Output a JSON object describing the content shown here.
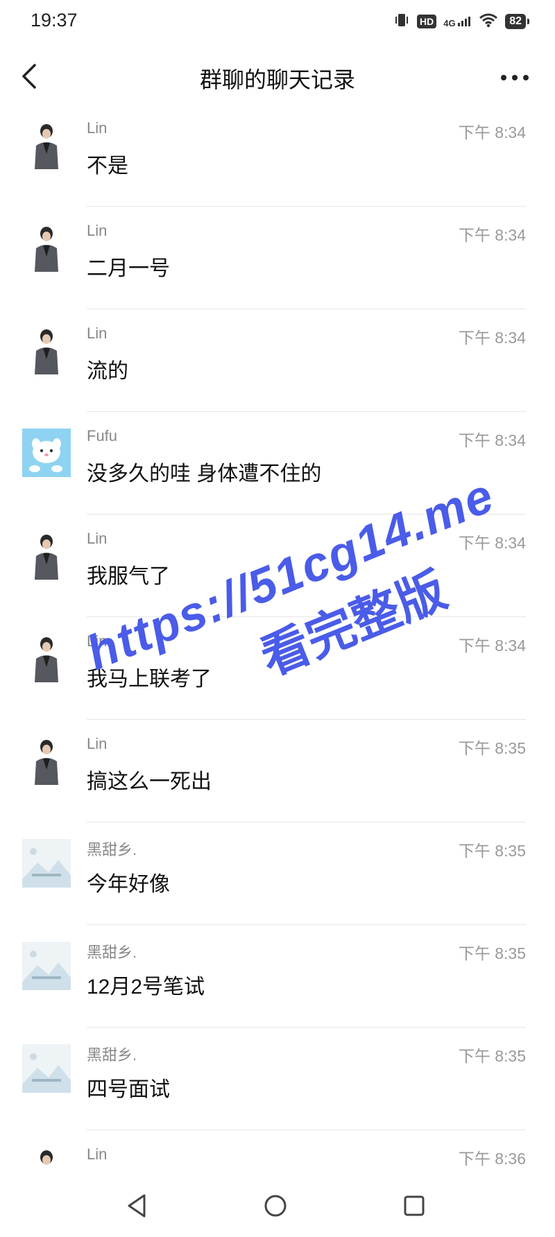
{
  "status_bar": {
    "time": "19:37",
    "hd": "HD",
    "network": "4G",
    "battery": "82"
  },
  "header": {
    "title": "群聊的聊天记录"
  },
  "messages": [
    {
      "sender": "Lin",
      "time": "下午 8:34",
      "text": "不是",
      "avatar": "man-avatar"
    },
    {
      "sender": "Lin",
      "time": "下午 8:34",
      "text": "二月一号",
      "avatar": "man-avatar"
    },
    {
      "sender": "Lin",
      "time": "下午 8:34",
      "text": "流的",
      "avatar": "man-avatar"
    },
    {
      "sender": "Fufu",
      "time": "下午 8:34",
      "text": "没多久的哇 身体遭不住的",
      "avatar": "cartoon-avatar"
    },
    {
      "sender": "Lin",
      "time": "下午 8:34",
      "text": "我服气了",
      "avatar": "man-avatar"
    },
    {
      "sender": "Lin",
      "time": "下午 8:34",
      "text": "我马上联考了",
      "avatar": "man-avatar"
    },
    {
      "sender": "Lin",
      "time": "下午 8:35",
      "text": "搞这么一死出",
      "avatar": "man-avatar"
    },
    {
      "sender": "黑甜乡.",
      "time": "下午 8:35",
      "text": "今年好像",
      "avatar": "landscape-avatar"
    },
    {
      "sender": "黑甜乡.",
      "time": "下午 8:35",
      "text": "12月2号笔试",
      "avatar": "landscape-avatar"
    },
    {
      "sender": "黑甜乡.",
      "time": "下午 8:35",
      "text": "四号面试",
      "avatar": "landscape-avatar"
    },
    {
      "sender": "Lin",
      "time": "下午 8:36",
      "text": "",
      "avatar": "man-avatar"
    }
  ],
  "watermark": {
    "line1": "https://51cg14.me",
    "line2": "看完整版"
  },
  "colors": {
    "watermark": "#4a5ce8",
    "divider": "#e6e6e6",
    "meta_text": "#999999"
  }
}
